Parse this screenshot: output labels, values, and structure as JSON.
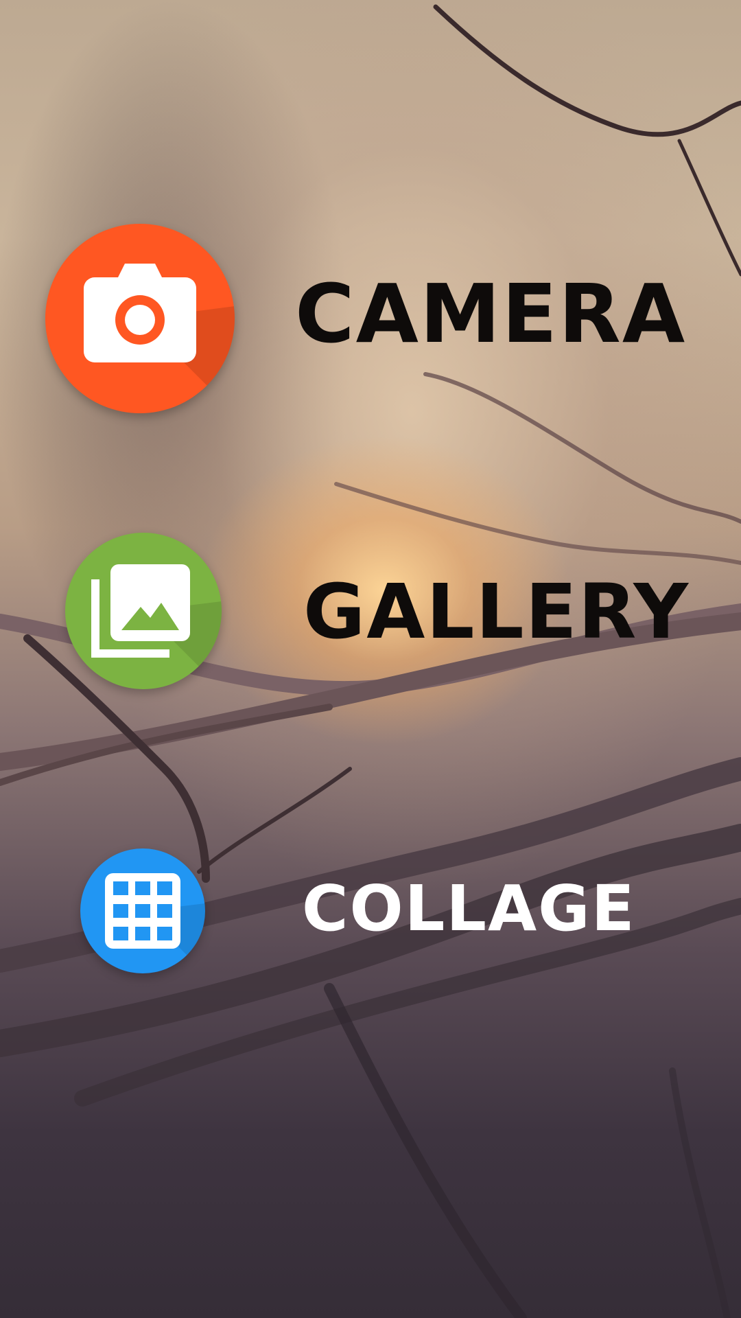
{
  "menu": {
    "items": [
      {
        "label": "CAMERA",
        "icon": "camera-icon",
        "color": "#FF5722",
        "text_color": "#0e0b0a"
      },
      {
        "label": "GALLERY",
        "icon": "photo-library-icon",
        "color": "#7CB342",
        "text_color": "#0e0b0a"
      },
      {
        "label": "COLLAGE",
        "icon": "grid-icon",
        "color": "#2196F3",
        "text_color": "#ffffff"
      }
    ]
  }
}
